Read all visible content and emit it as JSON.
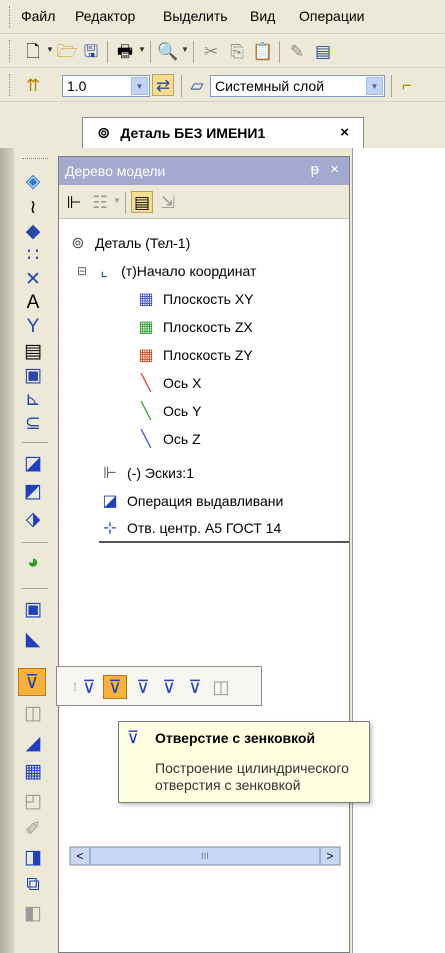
{
  "menu": {
    "items": [
      {
        "label": "Файл"
      },
      {
        "label": "Редактор"
      },
      {
        "label": "Выделить"
      },
      {
        "label": "Вид"
      },
      {
        "label": "Операции"
      }
    ]
  },
  "toolbar2": {
    "scale_value": "1.0",
    "layer_value": "Системный слой"
  },
  "document_tab": {
    "title": "Деталь БЕЗ ИМЕНИ1",
    "close": "×"
  },
  "tree": {
    "header": "Дерево модели",
    "pin": "ᵽ",
    "close": "×",
    "rows": [
      {
        "label": "Деталь (Тел-1)"
      },
      {
        "label": "(т)Начало координат",
        "expander": "⊟"
      },
      {
        "label": "Плоскость XY"
      },
      {
        "label": "Плоскость ZX"
      },
      {
        "label": "Плоскость ZY"
      },
      {
        "label": "Ось X"
      },
      {
        "label": "Ось Y"
      },
      {
        "label": "Ось Z"
      },
      {
        "label": "(-) Эскиз:1"
      },
      {
        "label": "Операция выдавливани"
      },
      {
        "label": "Отв. центр. А5 ГОСТ 14"
      }
    ],
    "scroll_left": "<",
    "scroll_right": ">",
    "scroll_grip": "III"
  },
  "tooltip": {
    "title": "Отверстие с зенковкой",
    "description": "Построение цилиндрического отверстия с зенковкой"
  },
  "colors": {
    "panel_header": "#a4a9cf",
    "tooltip_bg": "#ffffe1",
    "accent_blue": "#1f3fbf",
    "highlight_orange": "#f7b23b"
  }
}
